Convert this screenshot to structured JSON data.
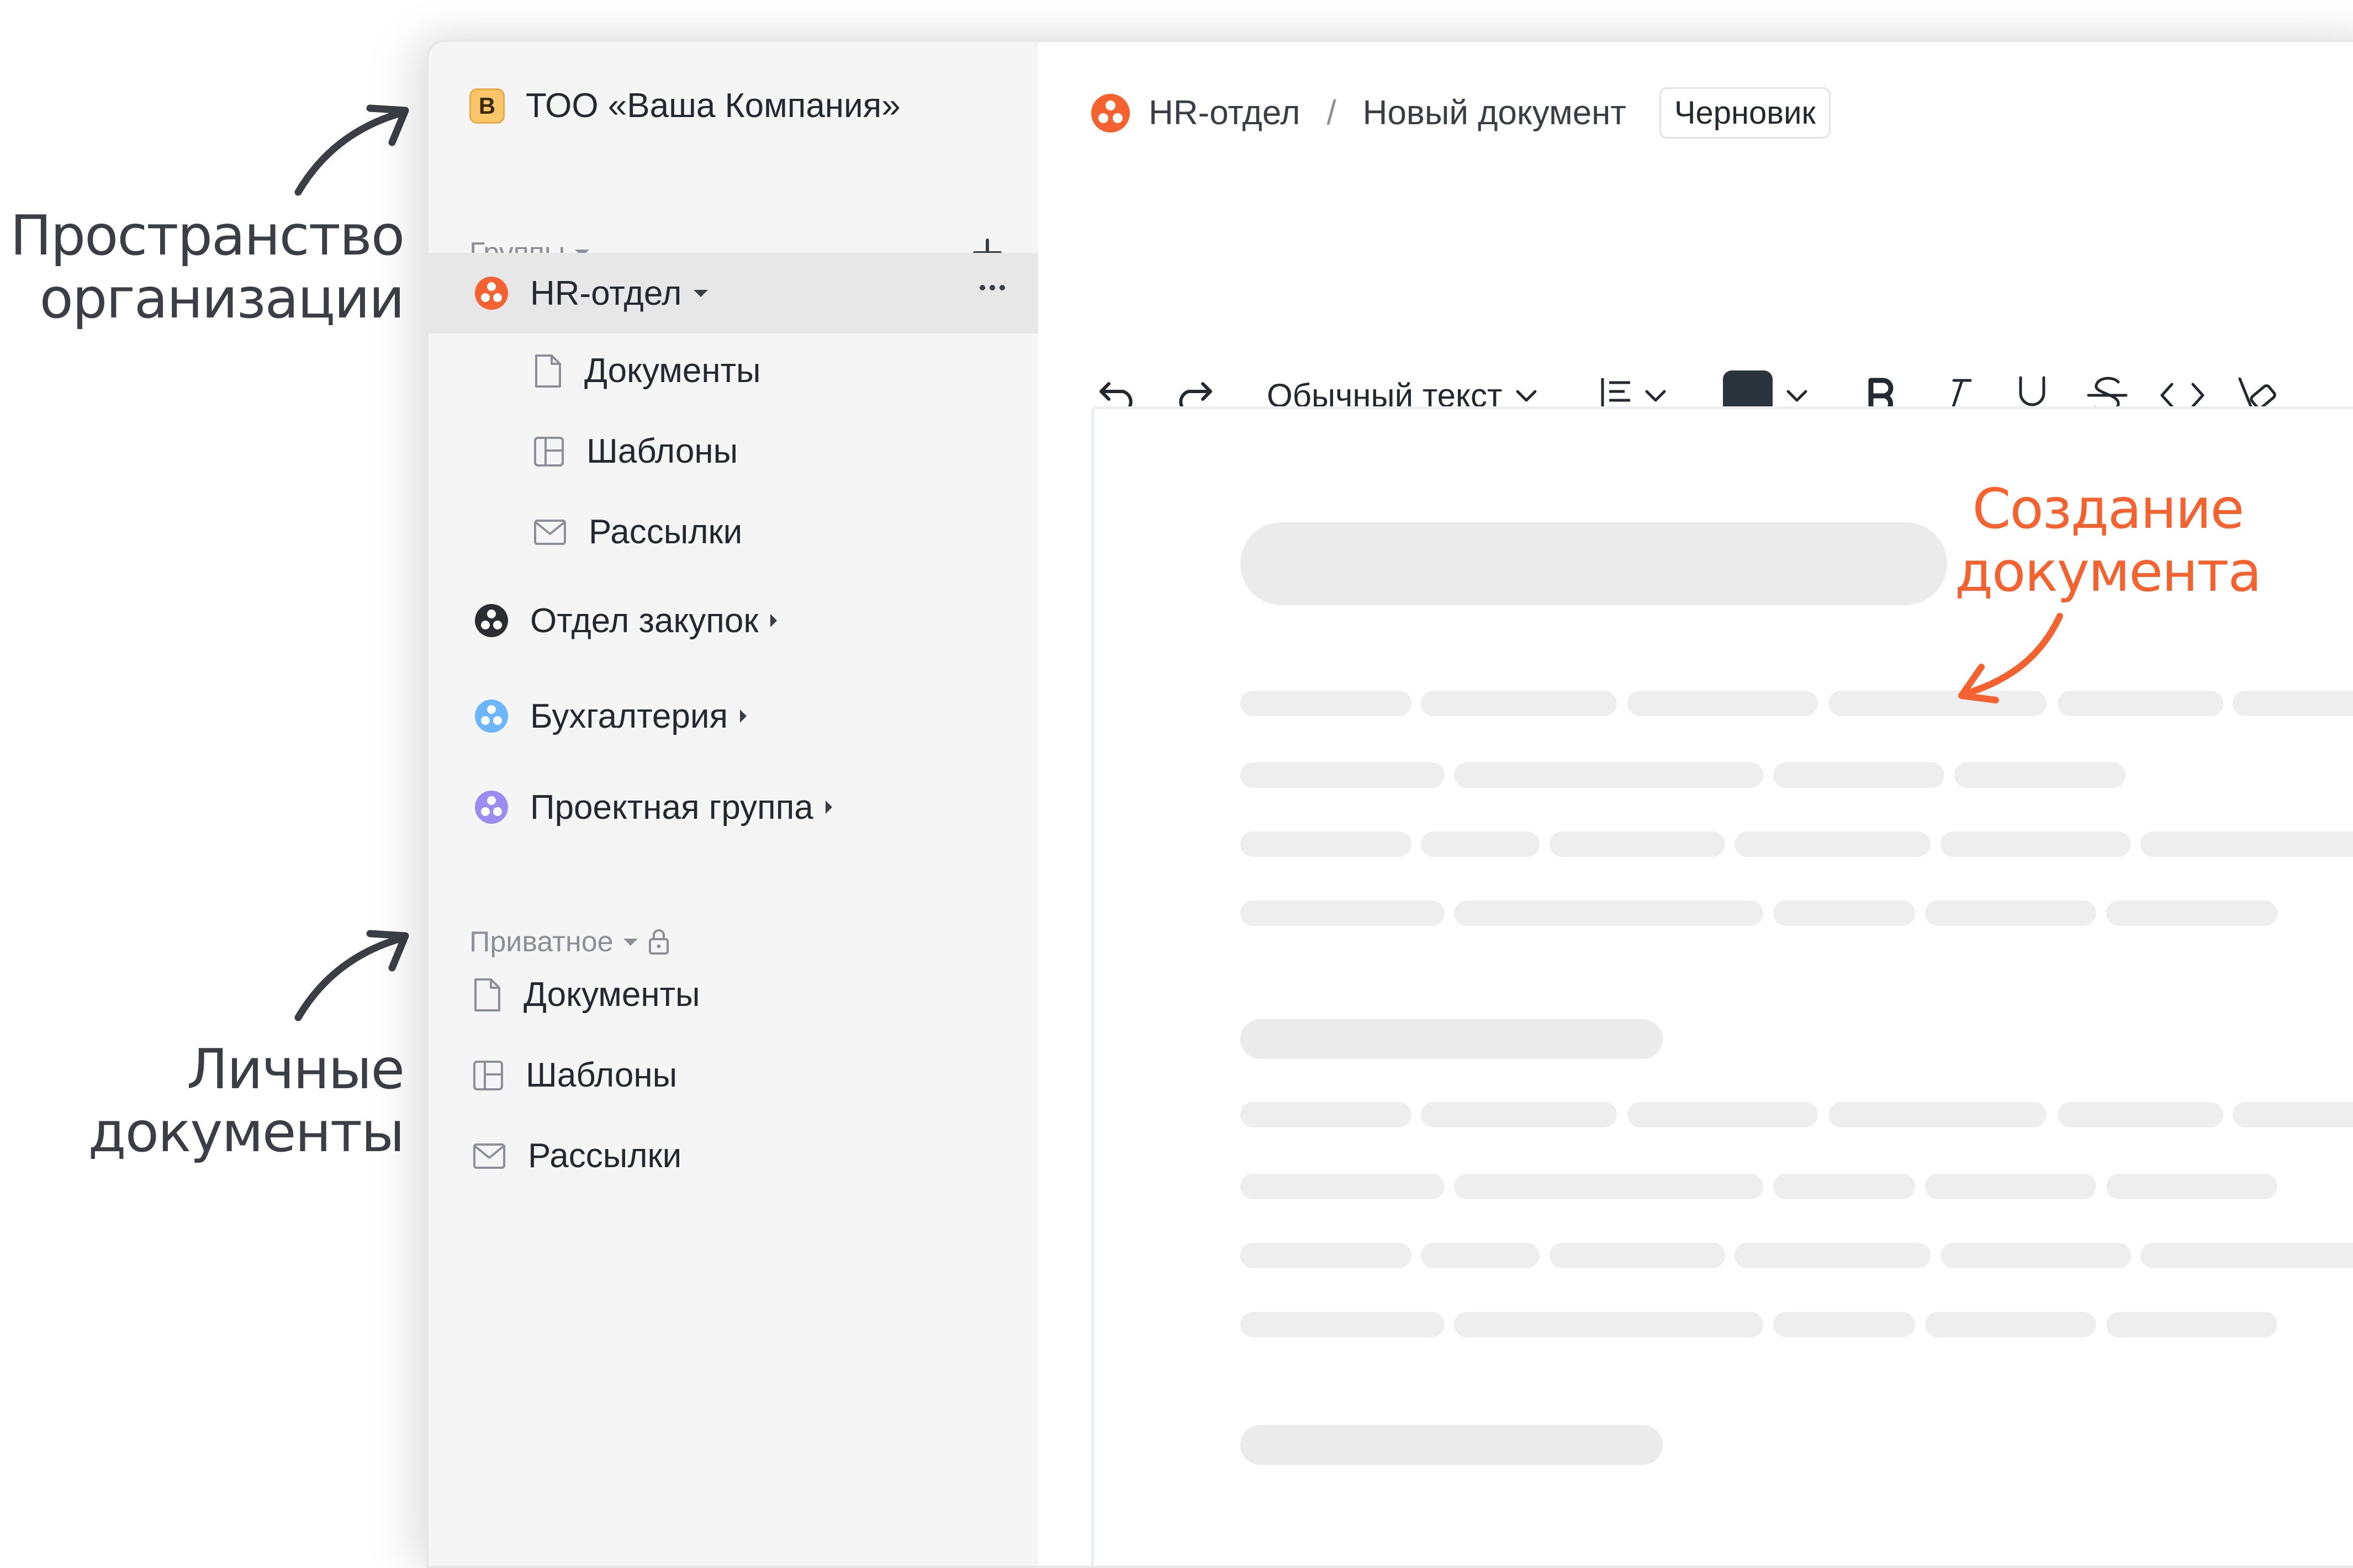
{
  "annotations": {
    "org_space": [
      "Пространство",
      "организации"
    ],
    "personal_docs": [
      "Личные",
      "документы"
    ],
    "create_doc": [
      "Создание",
      "документа"
    ]
  },
  "org": {
    "badge_letter": "В",
    "name": "ТОО «Ваша Компания»"
  },
  "sidebar": {
    "groups_label": "Группы",
    "groups": [
      {
        "label": "HR-отдел",
        "color": "#f4622f",
        "expanded": true,
        "children": [
          "Документы",
          "Шаблоны",
          "Рассылки"
        ]
      },
      {
        "label": "Отдел закупок",
        "color": "#2b2d31"
      },
      {
        "label": "Бухгалтерия",
        "color": "#6cb5ff"
      },
      {
        "label": "Проектная группа",
        "color": "#9b8cf2"
      }
    ],
    "private_label": "Приватное",
    "private_items": [
      "Документы",
      "Шаблоны",
      "Рассылки"
    ]
  },
  "breadcrumb": {
    "group": "HR-отдел",
    "separator": "/",
    "document": "Новый документ",
    "status": "Черновик"
  },
  "toolbar": {
    "text_style": "Обычный текст",
    "text_color": "#2b333d",
    "icons": [
      "undo-icon",
      "redo-icon",
      "align-icon",
      "bold-icon",
      "italic-icon",
      "underline-icon",
      "strikethrough-icon",
      "code-icon",
      "clear-format-icon"
    ]
  },
  "colors": {
    "accent": "#f4622f",
    "sidebar_bg": "#f5f5f5",
    "active_row": "#e7e7e7"
  }
}
